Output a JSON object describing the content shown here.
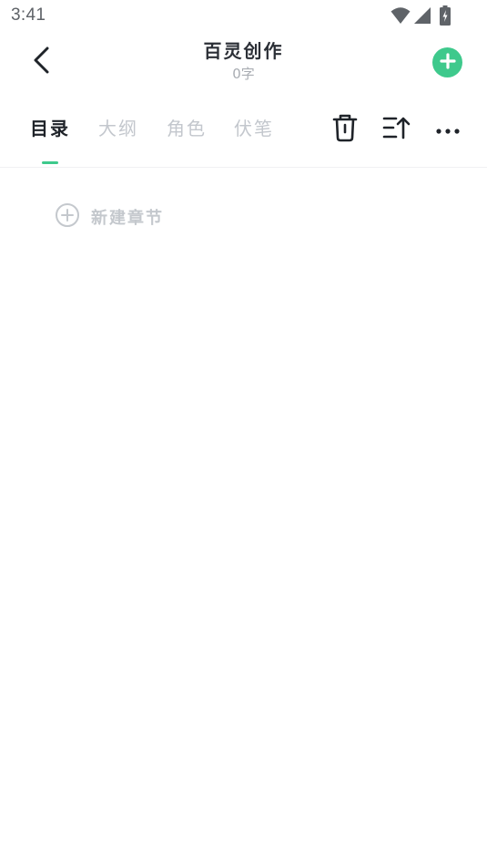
{
  "status_bar": {
    "time": "3:41",
    "icons": [
      "wifi-icon",
      "cell-signal-icon",
      "battery-icon"
    ]
  },
  "header": {
    "back_icon": "chevron-left-icon",
    "title": "百灵创作",
    "subtitle": "0字",
    "add_icon": "plus-circle-icon",
    "accent_color": "#3ec98c"
  },
  "tabs": [
    {
      "label": "目录",
      "active": true
    },
    {
      "label": "大纲",
      "active": false
    },
    {
      "label": "角色",
      "active": false
    },
    {
      "label": "伏笔",
      "active": false
    }
  ],
  "toolbar": {
    "icons": [
      "trash-icon",
      "sort-ascending-icon",
      "more-icon"
    ]
  },
  "content": {
    "new_chapter_icon": "plus-circle-outline-icon",
    "new_chapter_label": "新建章节"
  }
}
